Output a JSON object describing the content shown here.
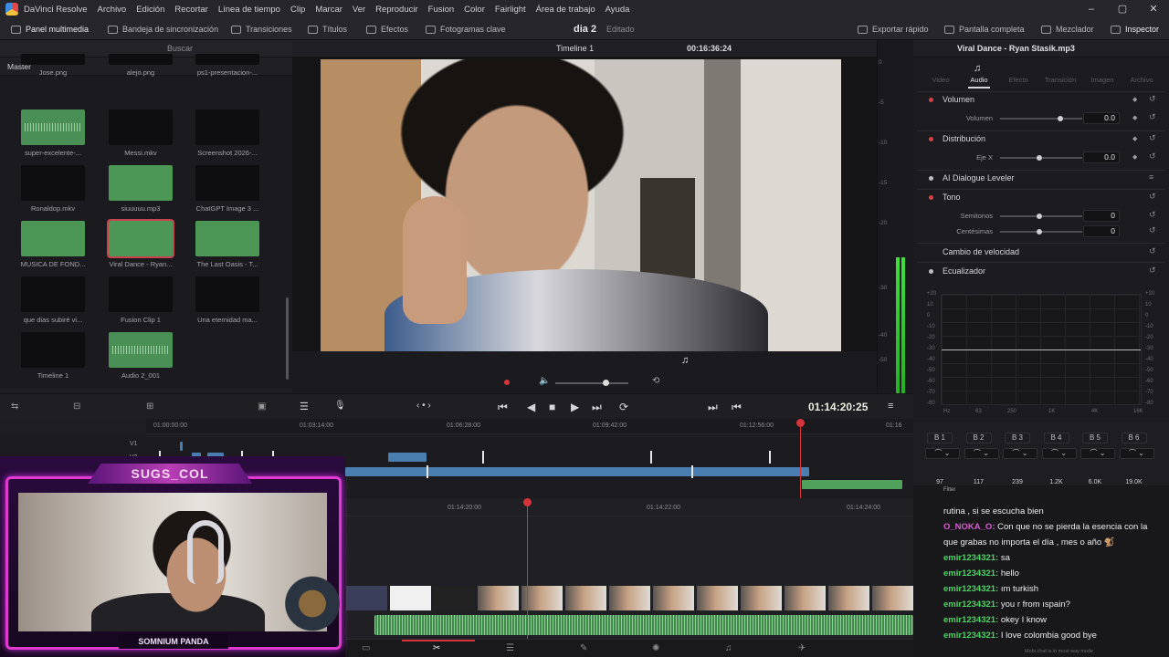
{
  "menu": [
    "Archivo",
    "Edición",
    "Recortar",
    "Línea de tiempo",
    "Clip",
    "Marcar",
    "Ver",
    "Reproducir",
    "Fusion",
    "Color",
    "Fairlight",
    "Área de trabajo",
    "Ayuda"
  ],
  "app_title": "DaVinci Resolve",
  "toolbar": {
    "media_pool": "Panel multimedia",
    "sync_bin": "Bandeja de sincronización",
    "transitions": "Transiciones",
    "titles": "Títulos",
    "effects": "Efectos",
    "keyframes": "Fotogramas clave",
    "project": "dia 2",
    "state": "Editado",
    "quick_export": "Exportar rápido",
    "fullscreen": "Pantalla completa",
    "mixer": "Mezclador",
    "inspector": "Inspector"
  },
  "media_pool": {
    "search_placeholder": "Buscar",
    "bin": "Master",
    "clips": [
      {
        "name": "Jose.png",
        "kind": "video"
      },
      {
        "name": "alejo.png",
        "kind": "video"
      },
      {
        "name": "ps1-presentacion-...",
        "kind": "video"
      },
      {
        "name": "super-excelente-...",
        "kind": "audio"
      },
      {
        "name": "Messi.mkv",
        "kind": "video"
      },
      {
        "name": "Screenshot 2026-...",
        "kind": "video"
      },
      {
        "name": "Ronaldop.mkv",
        "kind": "video"
      },
      {
        "name": "siuuuuu.mp3",
        "kind": "green"
      },
      {
        "name": "ChatGPT Image 3 ...",
        "kind": "video"
      },
      {
        "name": "MUSICA DE FOND...",
        "kind": "green"
      },
      {
        "name": "Viral Dance - Ryan...",
        "kind": "green-selected"
      },
      {
        "name": "The Last Oasis - T...",
        "kind": "green"
      },
      {
        "name": "que dias subiré vi...",
        "kind": "video"
      },
      {
        "name": "Fusion Clip 1",
        "kind": "video"
      },
      {
        "name": "Una eternidad ma...",
        "kind": "video"
      },
      {
        "name": "Timeline 1",
        "kind": "video"
      },
      {
        "name": "Audio 2_001",
        "kind": "audio"
      }
    ]
  },
  "viewer": {
    "timeline_name": "Timeline 1",
    "timecode": "00:16:36:24",
    "transport_timecode": "01:14:20:25"
  },
  "meter_ticks": [
    "0",
    "-5",
    "-10",
    "-15",
    "-20",
    "-30",
    "-40",
    "-50"
  ],
  "inspector": {
    "clip_title": "Viral Dance - Ryan Stasik.mp3",
    "tabs": [
      "Video",
      "Audio",
      "Efecto",
      "Transición",
      "Imagen",
      "Archivo"
    ],
    "active_tab": "Audio",
    "sections": {
      "volume": {
        "title": "Volumen",
        "param": "Volumen",
        "value": "0.0"
      },
      "pan": {
        "title": "Distribución",
        "param": "Eje X",
        "value": "0.0"
      },
      "dialogue": {
        "title": "AI Dialogue Leveler"
      },
      "pitch": {
        "title": "Tono",
        "semitones_label": "Semitonos",
        "semitones": "0",
        "cents_label": "Centésimas",
        "cents": "0"
      },
      "speed": {
        "title": "Cambio de velocidad"
      },
      "eq": {
        "title": "Ecualizador"
      }
    },
    "eq_y_labels": [
      "+20",
      "10",
      "0",
      "-10",
      "-20",
      "-30",
      "-40",
      "-50",
      "-60",
      "-70",
      "-80"
    ],
    "eq_x_labels": [
      "Hz",
      "63",
      "250",
      "1K",
      "4K",
      "16K"
    ],
    "bands": [
      "B 1",
      "B 2",
      "B 3",
      "B 4",
      "B 5",
      "B 6"
    ],
    "band_values": [
      "97",
      "117",
      "239",
      "1.2K",
      "6.0K",
      "19.0K"
    ]
  },
  "timeline": {
    "ruler_top": [
      "01:00:00:00",
      "01:03:14:00",
      "01:06:28:00",
      "01:09:42:00",
      "01:12:56:00",
      "01:16"
    ],
    "ruler_bottom": [
      "01:14:20:00",
      "01:14:22:00",
      "01:14:24:00"
    ],
    "tracks": [
      "V1",
      "V2"
    ]
  },
  "pages": [
    "media",
    "cut",
    "edit",
    "fusion",
    "color",
    "fairlight",
    "deliver"
  ],
  "webcam": {
    "banner": "SUGS_COL",
    "name": "SOMNIUM PANDA"
  },
  "chat": {
    "filter_label": "Filter",
    "messages": [
      {
        "user": "",
        "text": "rutina , si se escucha bien",
        "color": "none"
      },
      {
        "user": "O_NOKA_O:",
        "text": " Con que no se pierda la esencia con la",
        "color": "pink"
      },
      {
        "user": "",
        "text": "que grabas no importa el día , mes o año 🐒",
        "color": "none"
      },
      {
        "user": "emir1234321:",
        "text": " sa",
        "color": "green"
      },
      {
        "user": "emir1234321:",
        "text": " hello",
        "color": "green"
      },
      {
        "user": "emir1234321:",
        "text": " ım turkish",
        "color": "green"
      },
      {
        "user": "emir1234321:",
        "text": " you r from ıspain?",
        "color": "green"
      },
      {
        "user": "emir1234321:",
        "text": " okey I know",
        "color": "green"
      },
      {
        "user": "emir1234321:",
        "text": " I love colombia good bye",
        "color": "green"
      }
    ],
    "footer": "Mobi chat is in most way mode"
  }
}
